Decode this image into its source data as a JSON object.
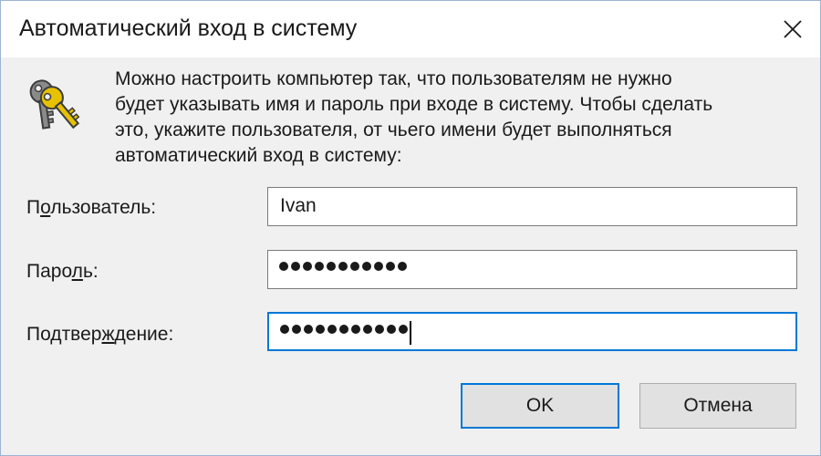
{
  "window": {
    "title": "Автоматический вход в систему",
    "close_icon": "close-icon"
  },
  "description": {
    "icon": "keys-icon",
    "lines": [
      "Можно настроить компьютер так, что пользователям не нужно",
      "будет указывать имя и пароль при входе в систему. Чтобы сделать",
      "это, укажите пользователя, от чьего имени будет выполняться",
      "автоматический вход в систему:"
    ]
  },
  "form": {
    "user": {
      "label_pre": "П",
      "label_ul": "о",
      "label_post": "льзователь:",
      "value": "Ivan"
    },
    "password": {
      "label_pre": "Паро",
      "label_ul": "л",
      "label_post": "ь:",
      "value": "●●●●●●●●●●●",
      "masked_length": 11
    },
    "confirm": {
      "label_pre": "Подтвер",
      "label_ul": "ж",
      "label_post": "дение:",
      "value": "●●●●●●●●●●●",
      "masked_length": 11,
      "focused": true
    }
  },
  "buttons": {
    "ok_label": "OK",
    "cancel_label": "Отмена"
  },
  "colors": {
    "accent": "#0078d7",
    "dialog_bg": "#f0f0f0",
    "key_gold": "#d8b400",
    "key_gray": "#7d7d7d"
  }
}
